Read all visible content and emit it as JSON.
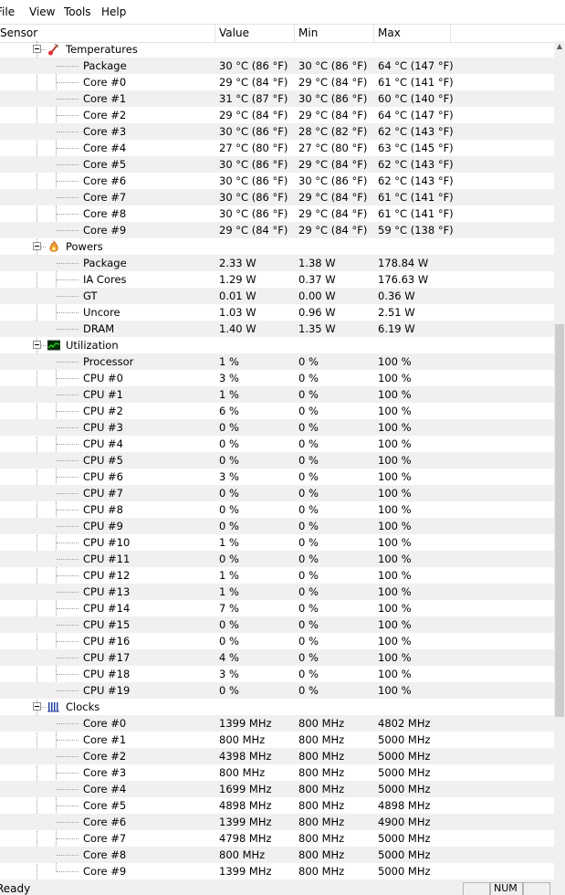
{
  "menu": [
    "File",
    "View",
    "Tools",
    "Help"
  ],
  "columns": {
    "sensor": "Sensor",
    "value": "Value",
    "min": "Min",
    "max": "Max"
  },
  "groups": [
    {
      "name": "Temperatures",
      "icon": "thermometer-icon",
      "rows": [
        [
          "Package",
          "30 °C  (86 °F)",
          "30 °C  (86 °F)",
          "64 °C  (147 °F)"
        ],
        [
          "Core #0",
          "29 °C  (84 °F)",
          "29 °C  (84 °F)",
          "61 °C  (141 °F)"
        ],
        [
          "Core #1",
          "31 °C  (87 °F)",
          "30 °C  (86 °F)",
          "60 °C  (140 °F)"
        ],
        [
          "Core #2",
          "29 °C  (84 °F)",
          "29 °C  (84 °F)",
          "64 °C  (147 °F)"
        ],
        [
          "Core #3",
          "30 °C  (86 °F)",
          "28 °C  (82 °F)",
          "62 °C  (143 °F)"
        ],
        [
          "Core #4",
          "27 °C  (80 °F)",
          "27 °C  (80 °F)",
          "63 °C  (145 °F)"
        ],
        [
          "Core #5",
          "30 °C  (86 °F)",
          "29 °C  (84 °F)",
          "62 °C  (143 °F)"
        ],
        [
          "Core #6",
          "30 °C  (86 °F)",
          "30 °C  (86 °F)",
          "62 °C  (143 °F)"
        ],
        [
          "Core #7",
          "30 °C  (86 °F)",
          "29 °C  (84 °F)",
          "61 °C  (141 °F)"
        ],
        [
          "Core #8",
          "30 °C  (86 °F)",
          "29 °C  (84 °F)",
          "61 °C  (141 °F)"
        ],
        [
          "Core #9",
          "29 °C  (84 °F)",
          "29 °C  (84 °F)",
          "59 °C  (138 °F)"
        ]
      ]
    },
    {
      "name": "Powers",
      "icon": "flame-icon",
      "rows": [
        [
          "Package",
          "2.33 W",
          "1.38 W",
          "178.84 W"
        ],
        [
          "IA Cores",
          "1.29 W",
          "0.37 W",
          "176.63 W"
        ],
        [
          "GT",
          "0.01 W",
          "0.00 W",
          "0.36 W"
        ],
        [
          "Uncore",
          "1.03 W",
          "0.96 W",
          "2.51 W"
        ],
        [
          "DRAM",
          "1.40 W",
          "1.35 W",
          "6.19 W"
        ]
      ]
    },
    {
      "name": "Utilization",
      "icon": "utilization-graph-icon",
      "rows": [
        [
          "Processor",
          "1 %",
          "0 %",
          "100 %"
        ],
        [
          "CPU #0",
          "3 %",
          "0 %",
          "100 %"
        ],
        [
          "CPU #1",
          "1 %",
          "0 %",
          "100 %"
        ],
        [
          "CPU #2",
          "6 %",
          "0 %",
          "100 %"
        ],
        [
          "CPU #3",
          "0 %",
          "0 %",
          "100 %"
        ],
        [
          "CPU #4",
          "0 %",
          "0 %",
          "100 %"
        ],
        [
          "CPU #5",
          "0 %",
          "0 %",
          "100 %"
        ],
        [
          "CPU #6",
          "3 %",
          "0 %",
          "100 %"
        ],
        [
          "CPU #7",
          "0 %",
          "0 %",
          "100 %"
        ],
        [
          "CPU #8",
          "0 %",
          "0 %",
          "100 %"
        ],
        [
          "CPU #9",
          "0 %",
          "0 %",
          "100 %"
        ],
        [
          "CPU #10",
          "1 %",
          "0 %",
          "100 %"
        ],
        [
          "CPU #11",
          "0 %",
          "0 %",
          "100 %"
        ],
        [
          "CPU #12",
          "1 %",
          "0 %",
          "100 %"
        ],
        [
          "CPU #13",
          "1 %",
          "0 %",
          "100 %"
        ],
        [
          "CPU #14",
          "7 %",
          "0 %",
          "100 %"
        ],
        [
          "CPU #15",
          "0 %",
          "0 %",
          "100 %"
        ],
        [
          "CPU #16",
          "0 %",
          "0 %",
          "100 %"
        ],
        [
          "CPU #17",
          "4 %",
          "0 %",
          "100 %"
        ],
        [
          "CPU #18",
          "3 %",
          "0 %",
          "100 %"
        ],
        [
          "CPU #19",
          "0 %",
          "0 %",
          "100 %"
        ]
      ]
    },
    {
      "name": "Clocks",
      "icon": "clock-bars-icon",
      "rows": [
        [
          "Core #0",
          "1399 MHz",
          "800 MHz",
          "4802 MHz"
        ],
        [
          "Core #1",
          "800 MHz",
          "800 MHz",
          "5000 MHz"
        ],
        [
          "Core #2",
          "4398 MHz",
          "800 MHz",
          "5000 MHz"
        ],
        [
          "Core #3",
          "800 MHz",
          "800 MHz",
          "5000 MHz"
        ],
        [
          "Core #4",
          "1699 MHz",
          "800 MHz",
          "5000 MHz"
        ],
        [
          "Core #5",
          "4898 MHz",
          "800 MHz",
          "4898 MHz"
        ],
        [
          "Core #6",
          "1399 MHz",
          "800 MHz",
          "4900 MHz"
        ],
        [
          "Core #7",
          "4798 MHz",
          "800 MHz",
          "5000 MHz"
        ],
        [
          "Core #8",
          "800 MHz",
          "800 MHz",
          "5000 MHz"
        ],
        [
          "Core #9",
          "1399 MHz",
          "800 MHz",
          "5000 MHz"
        ]
      ]
    }
  ],
  "status": {
    "left": "Ready",
    "num": "NUM"
  }
}
